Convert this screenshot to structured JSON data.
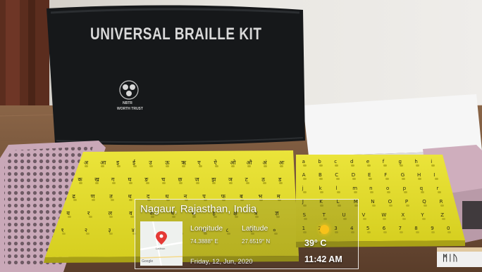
{
  "bag": {
    "title": "UNIVERSAL BRAILLE KIT",
    "logo_text": "NBTR",
    "org": "WORTH TRUST"
  },
  "overlay": {
    "location": "Nagaur, Rajasthan, India",
    "longitude_label": "Longitude",
    "longitude_value": "74.3888° E",
    "latitude_label": "Latitude",
    "latitude_value": "27.6519° N",
    "date": "Friday, 12, Jun, 2020",
    "temperature": "39° C",
    "time": "11:42 AM",
    "weather_icon": "sun-icon",
    "map_label": "Google",
    "map_place": "Ladnun"
  },
  "boards": {
    "english_rows": [
      [
        "a",
        "b",
        "c",
        "d",
        "e",
        "f",
        "g",
        "h",
        "i"
      ],
      [
        "A",
        "B",
        "C",
        "D",
        "E",
        "F",
        "G",
        "H",
        "I"
      ],
      [
        "j",
        "k",
        "l",
        "m",
        "n",
        "o",
        "p",
        "q",
        "r"
      ],
      [
        "J",
        "K",
        "L",
        "M",
        "N",
        "O",
        "P",
        "Q",
        "R"
      ],
      [
        "S",
        "T",
        "U",
        "V",
        "W",
        "X",
        "Y",
        "Z"
      ],
      [
        "1",
        "2",
        "3",
        "4",
        "5",
        "6",
        "7",
        "8",
        "9",
        "0"
      ]
    ],
    "hindi_rows": [
      [
        "अ",
        "आ",
        "इ",
        "ई",
        "उ",
        "ऊ",
        "ऋ",
        "ए",
        "ऐ",
        "ओ",
        "औ",
        "अं",
        "अः"
      ],
      [
        "क",
        "ख",
        "ग",
        "घ",
        "ङ",
        "च",
        "छ",
        "ज",
        "झ",
        "ञ",
        "ट",
        "ठ",
        "ड"
      ],
      [
        "ढ",
        "ण",
        "त",
        "थ",
        "द",
        "ध",
        "न",
        "प",
        "फ",
        "ब",
        "भ",
        "म"
      ],
      [
        "य",
        "र",
        "ल",
        "व",
        "श",
        "ष",
        "स",
        "ह",
        "क्ष",
        "त्र",
        "ज्ञ"
      ],
      [
        "१",
        "२",
        "३",
        "४",
        "५",
        "६",
        "७",
        "८",
        "९",
        "०"
      ]
    ]
  },
  "tag": {
    "text": "ᛗᛁᚢ"
  },
  "colors": {
    "wall": "#e8e6e1",
    "table": "#6b4a34",
    "bag": "#16181a",
    "board": "#e2db2b",
    "tray": "#c9a8b8",
    "paper": "#f6f6f6"
  }
}
